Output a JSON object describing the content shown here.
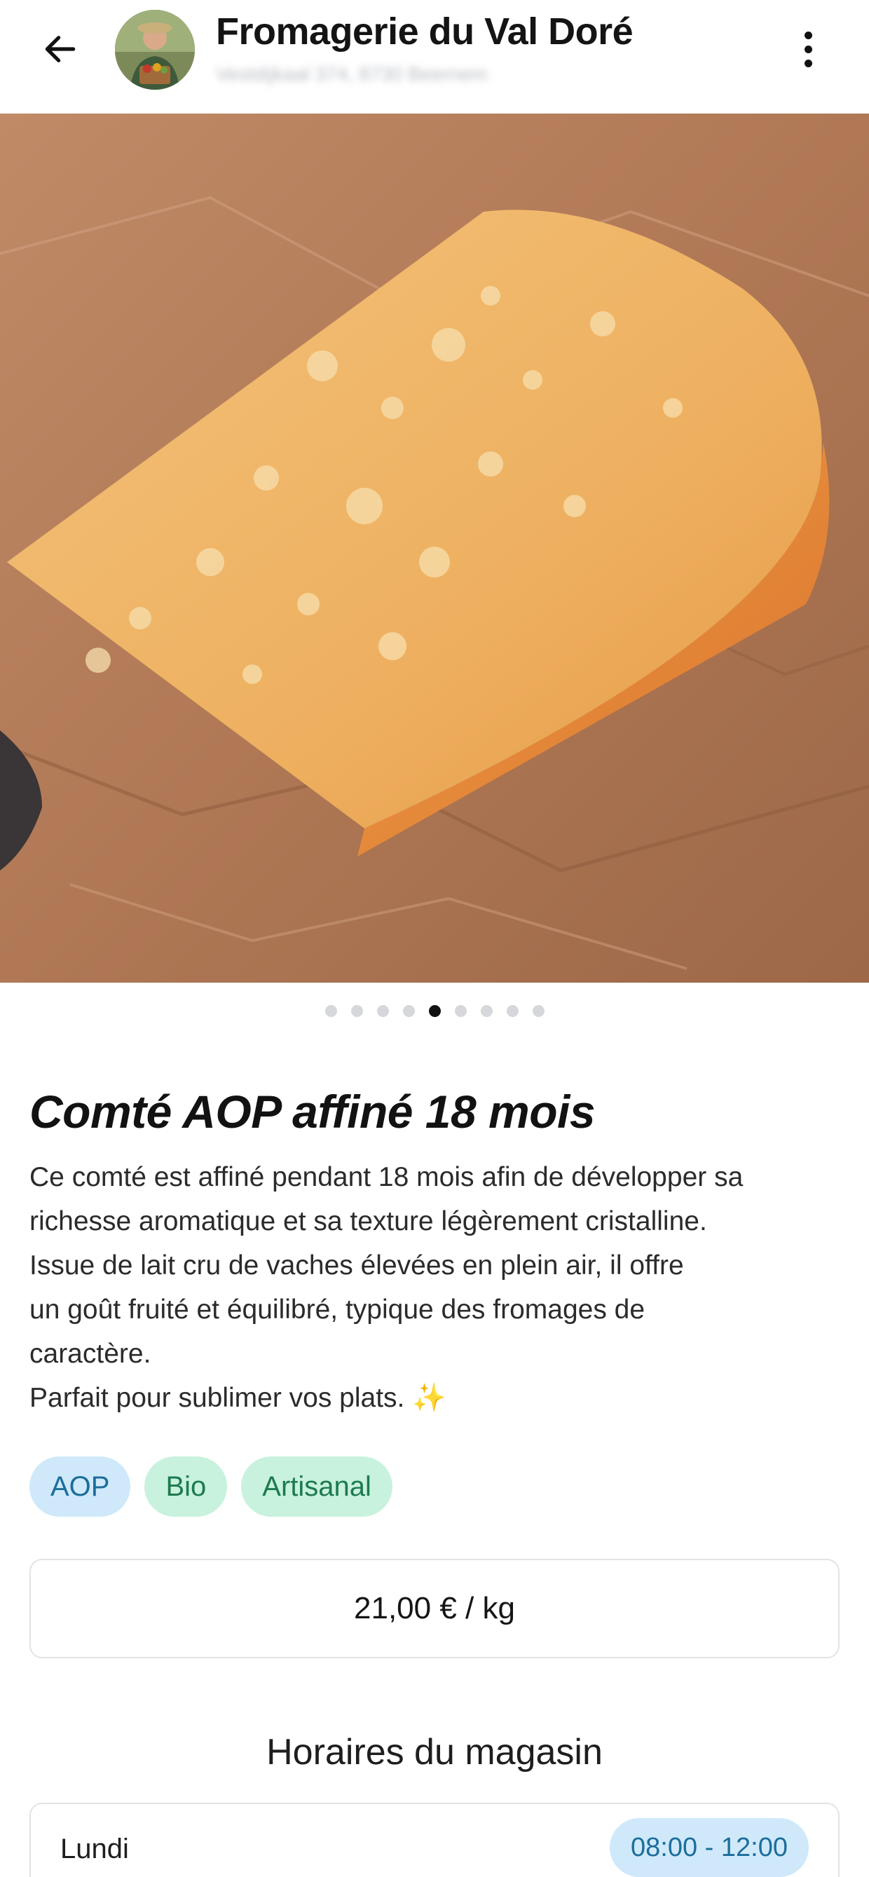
{
  "header": {
    "back_icon": "arrow-left-icon",
    "shop_name": "Fromagerie du Val Doré",
    "shop_address": "Vestdijkaal 374, 8730 Beernem",
    "more_icon": "more-vertical-icon"
  },
  "carousel": {
    "image": "comte-cheese-wedge-photo",
    "total_slides": 9,
    "active_slide": 5
  },
  "product": {
    "name": "Comté AOP affiné 18 mois",
    "description_lines": [
      "Ce comté est affiné pendant 18 mois afin de développer sa",
      "richesse aromatique et sa texture légèrement cristalline.",
      "Issue de lait cru de vaches élevées en plein air, il offre",
      "un goût fruité et équilibré, typique des fromages de",
      "caractère.",
      "Parfait pour sublimer vos plats. ✨"
    ],
    "tags": [
      {
        "label": "AOP",
        "color": "#cfe9fb"
      },
      {
        "label": "Bio",
        "color": "#c8f2dd"
      },
      {
        "label": "Artisanal",
        "color": "#c8f2dd"
      }
    ],
    "price": "21,00 € / kg"
  },
  "hours": {
    "title": "Horaires du magasin",
    "rows": [
      {
        "day": "Lundi",
        "time": "08:00 - 12:00"
      }
    ]
  },
  "colors": {
    "accent_blue": "#cfe9fb",
    "accent_green": "#c8f2dd",
    "text": "#1c1c1c"
  }
}
